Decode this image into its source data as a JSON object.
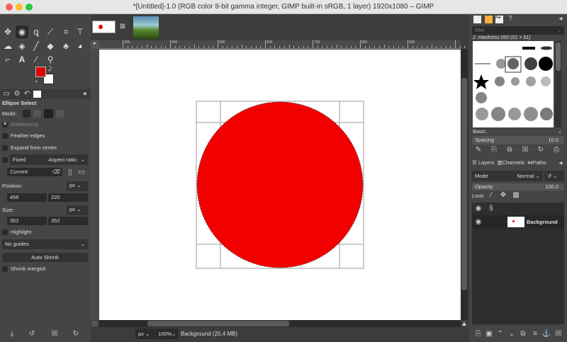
{
  "window": {
    "title": "*[Untitled]-1.0 (RGB color 8-bit gamma integer, GIMP built-in sRGB, 1 layer) 1920x1080 – GIMP"
  },
  "colors": {
    "foreground": "#e00000",
    "background": "#ffffff",
    "circle": "#f20000"
  },
  "tool_options": {
    "title": "Ellipse Select",
    "mode_label": "Mode:",
    "antialiasing": "Antialiasing",
    "feather": "Feather edges",
    "expand": "Expand from center",
    "fixed": "Fixed",
    "fixed_option": "Aspect ratio",
    "current": "Current",
    "position_label": "Position:",
    "position_unit": "px",
    "pos_x": "456",
    "pos_y": "220",
    "size_label": "Size:",
    "size_unit": "px",
    "size_w": "352",
    "size_h": "352",
    "highlight": "Highlight",
    "guides": "No guides",
    "auto_shrink": "Auto Shrink",
    "shrink_merged": "Shrink merged"
  },
  "rulers": {
    "h_labels": [
      "300",
      "400",
      "500",
      "600",
      "700",
      "800",
      "900"
    ]
  },
  "status": {
    "unit": "px",
    "zoom": "100%",
    "info": "Background (20.4 MB)"
  },
  "brushes": {
    "filter_placeholder": "filter",
    "current": "2. Hardness 050 (51 × 51)",
    "tag": "Basic,",
    "spacing_label": "Spacing",
    "spacing": "10.0"
  },
  "layers": {
    "tabs": [
      "Layers",
      "Channels",
      "Paths"
    ],
    "mode_label": "Mode",
    "mode": "Normal",
    "opacity_label": "Opacity",
    "opacity": "100.0",
    "lock_label": "Lock:",
    "items": [
      {
        "name": "Background"
      }
    ]
  }
}
